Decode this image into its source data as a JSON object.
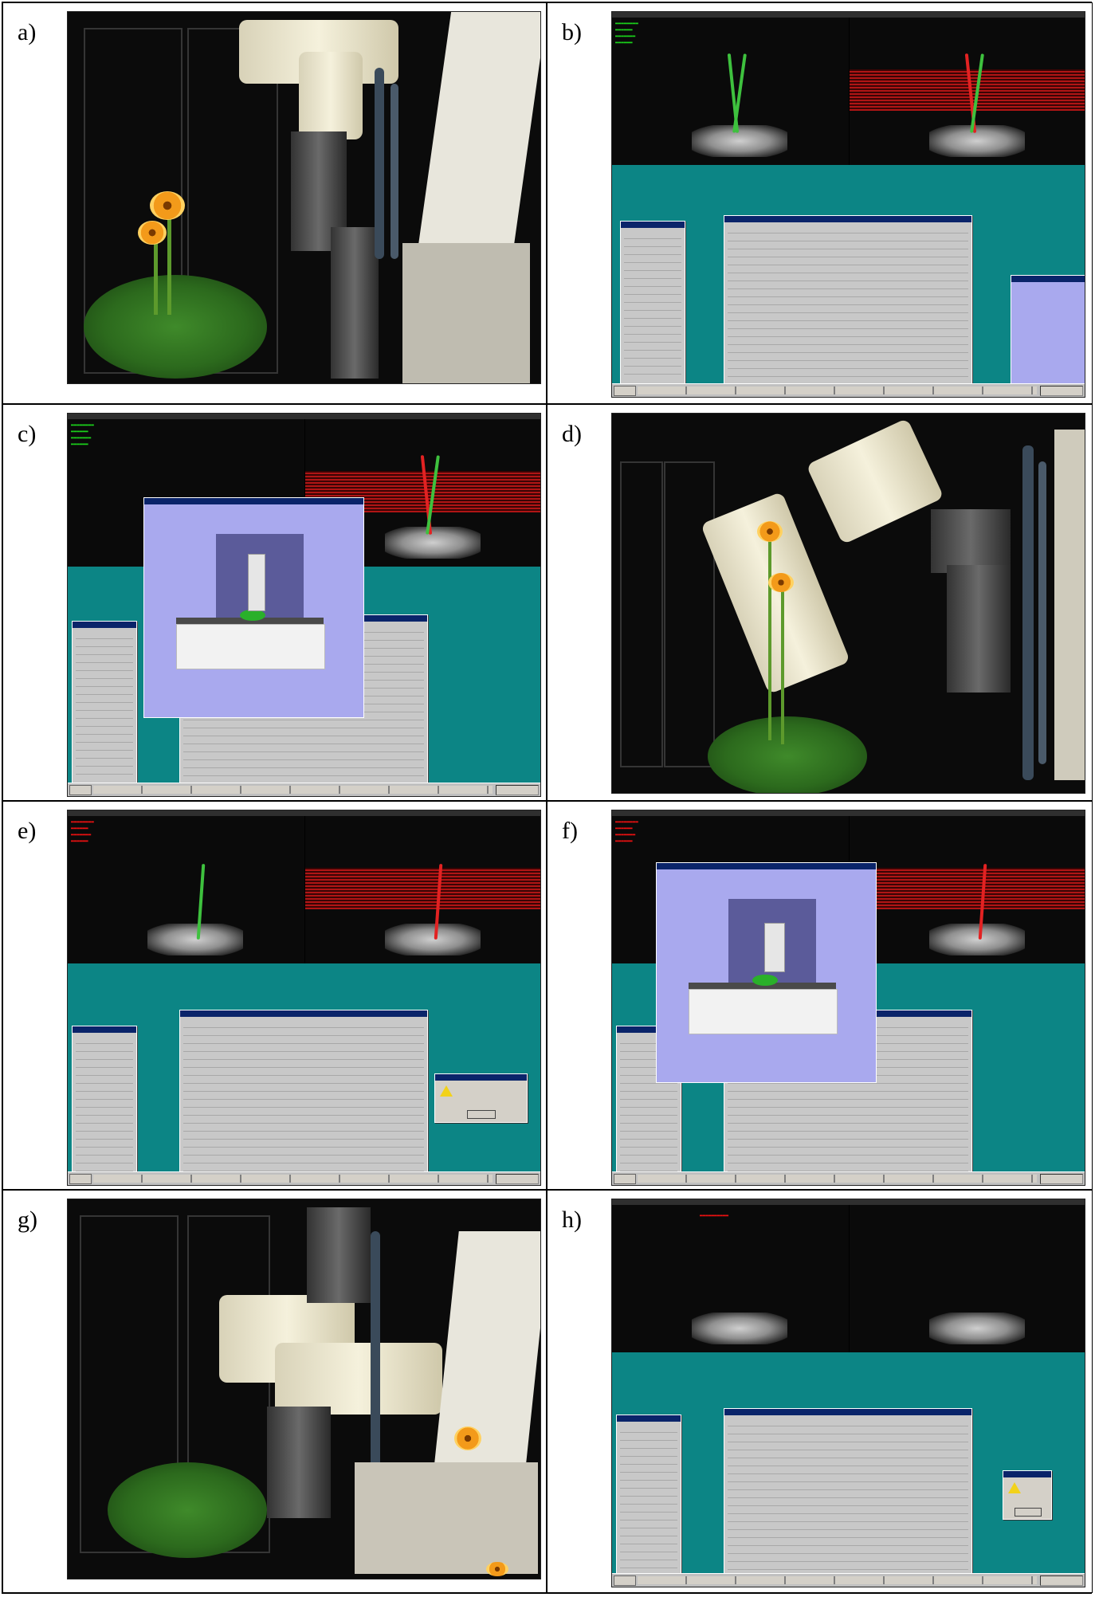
{
  "panels": [
    {
      "label": "a)",
      "kind": "photo"
    },
    {
      "label": "b)",
      "kind": "screen"
    },
    {
      "label": "c)",
      "kind": "screen"
    },
    {
      "label": "d)",
      "kind": "photo"
    },
    {
      "label": "e)",
      "kind": "screen"
    },
    {
      "label": "f)",
      "kind": "screen"
    },
    {
      "label": "g)",
      "kind": "photo"
    },
    {
      "label": "h)",
      "kind": "screen"
    }
  ],
  "colors": {
    "desktop": "#0c8585",
    "camera_bg": "#0a0a0a",
    "stripe": "#b01515",
    "stem_left": "#3ec13e",
    "stem_right": "#e22222",
    "sim_bg": "#a9a9ee",
    "title_bar": "#0a246a",
    "gerbera": "#f39a1a"
  }
}
